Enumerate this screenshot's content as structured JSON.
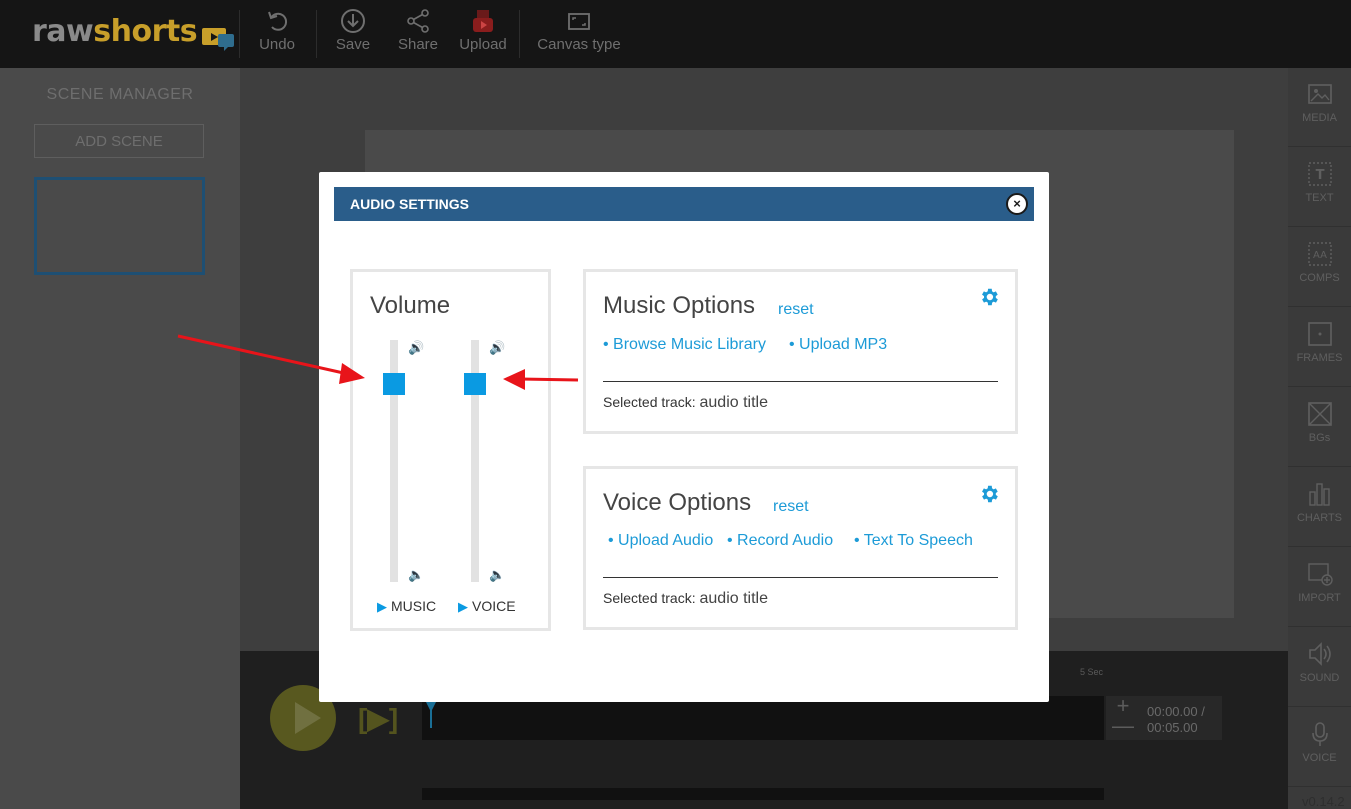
{
  "app": {
    "logo_raw": "raw",
    "logo_shorts": "shorts",
    "version": "v0.14.2"
  },
  "toolbar": {
    "undo_label": "Undo",
    "save_label": "Save",
    "share_label": "Share",
    "upload_label": "Upload",
    "canvas_type_label": "Canvas type"
  },
  "scene_manager": {
    "title": "SCENE MANAGER",
    "add_scene_label": "ADD SCENE"
  },
  "right_panel": {
    "items": [
      {
        "label": "MEDIA",
        "icon": "image-icon"
      },
      {
        "label": "TEXT",
        "icon": "text-icon"
      },
      {
        "label": "COMPS",
        "icon": "comps-icon"
      },
      {
        "label": "FRAMES",
        "icon": "frame-icon"
      },
      {
        "label": "BGs",
        "icon": "background-icon"
      },
      {
        "label": "CHARTS",
        "icon": "chart-icon"
      },
      {
        "label": "IMPORT",
        "icon": "import-icon"
      },
      {
        "label": "SOUND",
        "icon": "speaker-icon"
      },
      {
        "label": "VOICE",
        "icon": "microphone-icon"
      }
    ]
  },
  "timeline": {
    "time_current": "00:00.00 /",
    "time_total": "00:05.00",
    "ruler_label": "5 Sec",
    "zoom_in": "+",
    "zoom_out": "—",
    "step_label": "[▶]"
  },
  "dialog": {
    "title": "AUDIO SETTINGS",
    "close_label": "×",
    "volume": {
      "title": "Volume",
      "music_label": "MUSIC",
      "voice_label": "VOICE",
      "music_level": 0.85,
      "voice_level": 0.85
    },
    "music_options": {
      "title": "Music Options",
      "reset_label": "reset",
      "browse_label": "• Browse Music Library",
      "upload_label": "• Upload MP3",
      "selected_label": "Selected track:",
      "selected_value": "audio title"
    },
    "voice_options": {
      "title": "Voice Options",
      "reset_label": "reset",
      "upload_label": "• Upload Audio",
      "record_label": "• Record Audio",
      "tts_label": "• Text To Speech",
      "selected_label": "Selected track:",
      "selected_value": "audio title"
    }
  },
  "colors": {
    "accent": "#0a9ae2",
    "header": "#2a5d8a",
    "arrow": "#e8141a"
  }
}
